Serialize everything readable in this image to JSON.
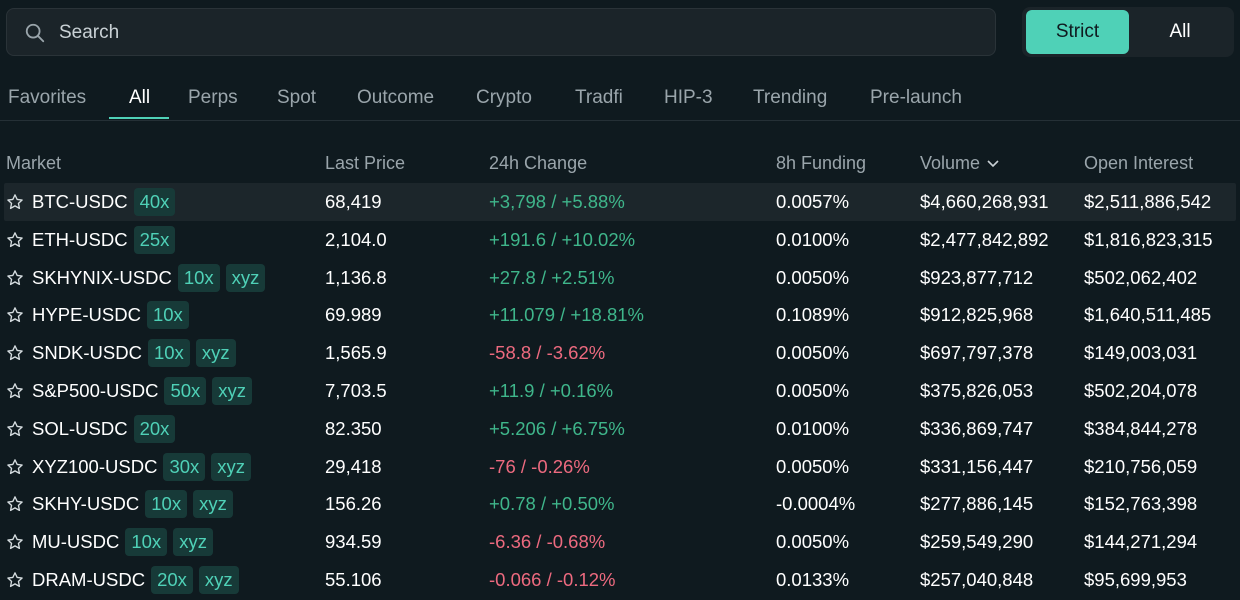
{
  "search": {
    "placeholder": "Search"
  },
  "segment": {
    "strict": "Strict",
    "all": "All"
  },
  "tabs": [
    "Favorites",
    "All",
    "Perps",
    "Spot",
    "Outcome",
    "Crypto",
    "Tradfi",
    "HIP-3",
    "Trending",
    "Pre-launch"
  ],
  "active_tab": "All",
  "columns": {
    "market": "Market",
    "last_price": "Last Price",
    "change_24h": "24h Change",
    "funding_8h": "8h Funding",
    "volume": "Volume",
    "open_interest": "Open Interest"
  },
  "colors": {
    "accent": "#4fd1b7",
    "positive": "#3fb68b",
    "negative": "#ed6a7f",
    "background": "#0f1a1f"
  },
  "rows": [
    {
      "market": "BTC-USDC",
      "leverage": "40x",
      "tag": "",
      "price": "68,419",
      "change": "+3,798 / +5.88%",
      "dir": "pos",
      "funding": "0.0057%",
      "volume": "$4,660,268,931",
      "oi": "$2,511,886,542"
    },
    {
      "market": "ETH-USDC",
      "leverage": "25x",
      "tag": "",
      "price": "2,104.0",
      "change": "+191.6 / +10.02%",
      "dir": "pos",
      "funding": "0.0100%",
      "volume": "$2,477,842,892",
      "oi": "$1,816,823,315"
    },
    {
      "market": "SKHYNIX-USDC",
      "leverage": "10x",
      "tag": "xyz",
      "price": "1,136.8",
      "change": "+27.8 / +2.51%",
      "dir": "pos",
      "funding": "0.0050%",
      "volume": "$923,877,712",
      "oi": "$502,062,402"
    },
    {
      "market": "HYPE-USDC",
      "leverage": "10x",
      "tag": "",
      "price": "69.989",
      "change": "+11.079 / +18.81%",
      "dir": "pos",
      "funding": "0.1089%",
      "volume": "$912,825,968",
      "oi": "$1,640,511,485"
    },
    {
      "market": "SNDK-USDC",
      "leverage": "10x",
      "tag": "xyz",
      "price": "1,565.9",
      "change": "-58.8 / -3.62%",
      "dir": "neg",
      "funding": "0.0050%",
      "volume": "$697,797,378",
      "oi": "$149,003,031"
    },
    {
      "market": "S&P500-USDC",
      "leverage": "50x",
      "tag": "xyz",
      "price": "7,703.5",
      "change": "+11.9 / +0.16%",
      "dir": "pos",
      "funding": "0.0050%",
      "volume": "$375,826,053",
      "oi": "$502,204,078"
    },
    {
      "market": "SOL-USDC",
      "leverage": "20x",
      "tag": "",
      "price": "82.350",
      "change": "+5.206 / +6.75%",
      "dir": "pos",
      "funding": "0.0100%",
      "volume": "$336,869,747",
      "oi": "$384,844,278"
    },
    {
      "market": "XYZ100-USDC",
      "leverage": "30x",
      "tag": "xyz",
      "price": "29,418",
      "change": "-76 / -0.26%",
      "dir": "neg",
      "funding": "0.0050%",
      "volume": "$331,156,447",
      "oi": "$210,756,059"
    },
    {
      "market": "SKHY-USDC",
      "leverage": "10x",
      "tag": "xyz",
      "price": "156.26",
      "change": "+0.78 / +0.50%",
      "dir": "pos",
      "funding": "-0.0004%",
      "volume": "$277,886,145",
      "oi": "$152,763,398"
    },
    {
      "market": "MU-USDC",
      "leverage": "10x",
      "tag": "xyz",
      "price": "934.59",
      "change": "-6.36 / -0.68%",
      "dir": "neg",
      "funding": "0.0050%",
      "volume": "$259,549,290",
      "oi": "$144,271,294"
    },
    {
      "market": "DRAM-USDC",
      "leverage": "20x",
      "tag": "xyz",
      "price": "55.106",
      "change": "-0.066 / -0.12%",
      "dir": "neg",
      "funding": "0.0133%",
      "volume": "$257,040,848",
      "oi": "$95,699,953"
    }
  ]
}
